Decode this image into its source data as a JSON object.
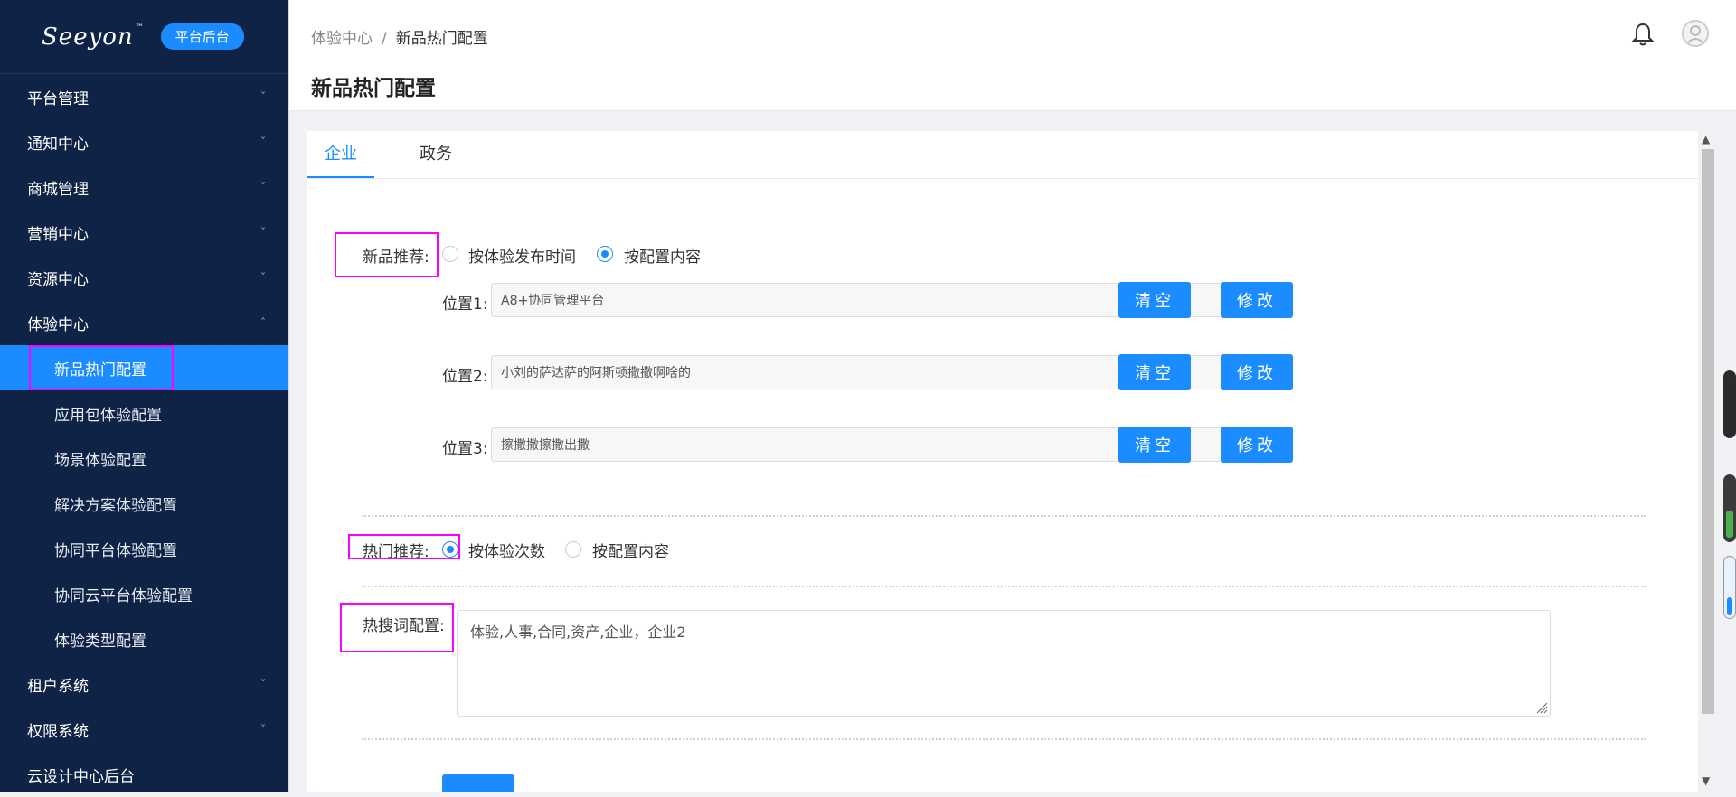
{
  "sidebar": {
    "logo_text": "Seeyon",
    "logo_tm": "™",
    "badge": "平台后台",
    "items": [
      {
        "label": "平台管理",
        "chev": "˅"
      },
      {
        "label": "通知中心",
        "chev": "˅"
      },
      {
        "label": "商城管理",
        "chev": "˅"
      },
      {
        "label": "营销中心",
        "chev": "˅"
      },
      {
        "label": "资源中心",
        "chev": "˅"
      },
      {
        "label": "体验中心",
        "chev": "˄"
      }
    ],
    "sub_items": [
      {
        "label": "新品热门配置"
      },
      {
        "label": "应用包体验配置"
      },
      {
        "label": "场景体验配置"
      },
      {
        "label": "解决方案体验配置"
      },
      {
        "label": "协同平台体验配置"
      },
      {
        "label": "协同云平台体验配置"
      },
      {
        "label": "体验类型配置"
      }
    ],
    "bottom_items": [
      {
        "label": "租户系统",
        "chev": "˅"
      },
      {
        "label": "权限系统",
        "chev": "˅"
      },
      {
        "label": "云设计中心后台",
        "chev": ""
      }
    ]
  },
  "header": {
    "breadcrumb_root": "体验中心",
    "breadcrumb_sep": "/",
    "breadcrumb_current": "新品热门配置",
    "title": "新品热门配置"
  },
  "tabs": [
    {
      "label": "企业",
      "active": true
    },
    {
      "label": "政务",
      "active": false
    }
  ],
  "new_products": {
    "label": "新品推荐:",
    "options": [
      {
        "label": "按体验发布时间",
        "checked": false
      },
      {
        "label": "按配置内容",
        "checked": true
      }
    ],
    "positions": [
      {
        "label": "位置1:",
        "value": "A8+协同管理平台"
      },
      {
        "label": "位置2:",
        "value": "小刘的萨达萨的阿斯顿撒撒啊啥的"
      },
      {
        "label": "位置3:",
        "value": "擦撒撒擦撒出撒"
      }
    ],
    "clear_label": "清空",
    "edit_label": "修改"
  },
  "hot": {
    "label": "热门推荐:",
    "options": [
      {
        "label": "按体验次数",
        "checked": true
      },
      {
        "label": "按配置内容",
        "checked": false
      }
    ]
  },
  "hot_search": {
    "label": "热搜词配置:",
    "value": "体验,人事,合同,资产,企业，企业2"
  },
  "colors": {
    "sidebar_bg": "#0f2347",
    "accent": "#1a8cff",
    "highlight": "#ff00ff"
  }
}
